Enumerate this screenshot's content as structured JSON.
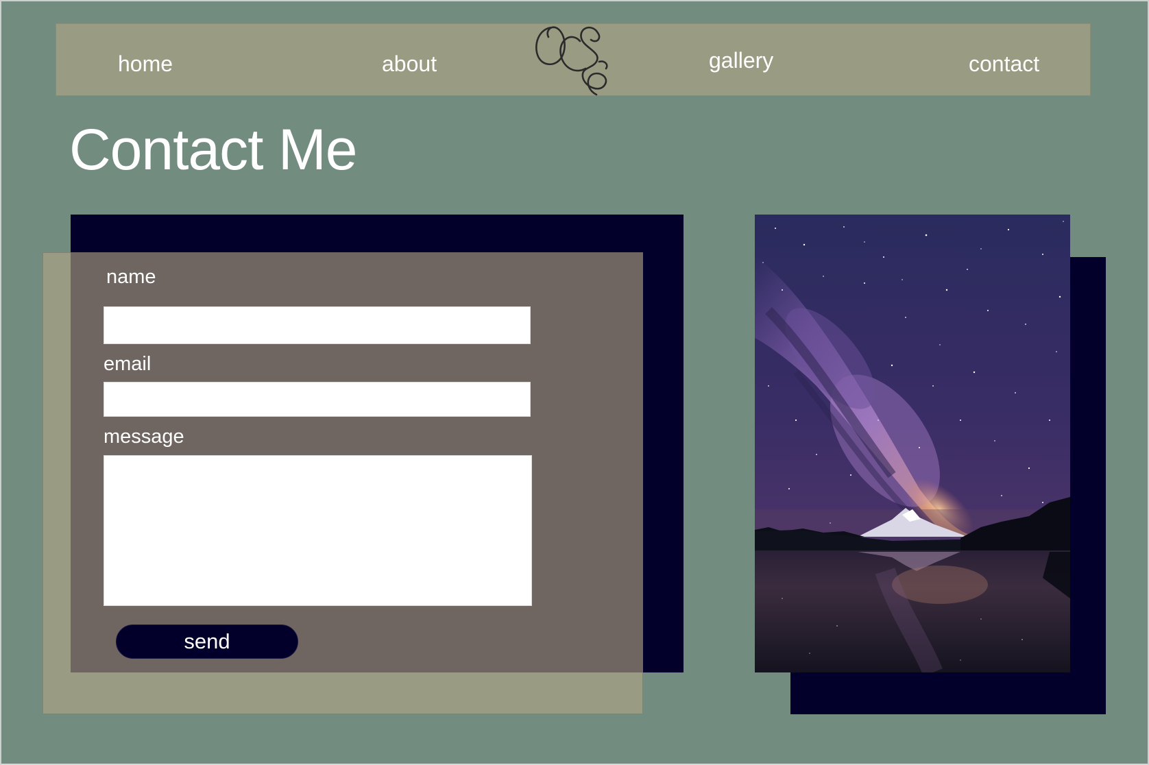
{
  "nav": {
    "links": [
      {
        "label": "home"
      },
      {
        "label": "about"
      },
      {
        "label": "gallery"
      },
      {
        "label": "contact"
      }
    ],
    "logo_letters": "OCS"
  },
  "page": {
    "title": "Contact Me"
  },
  "form": {
    "name_label": "name",
    "name_value": "",
    "email_label": "email",
    "email_value": "",
    "message_label": "message",
    "message_value": "",
    "send_label": "send"
  },
  "photo": {
    "subject": "night-sky-milky-way-over-mountain-lake"
  },
  "colors": {
    "background": "#728c80",
    "nav_bar": "#999c82",
    "navy": "#02002a",
    "form_panel": "#6f6561",
    "text": "#ffffff"
  }
}
